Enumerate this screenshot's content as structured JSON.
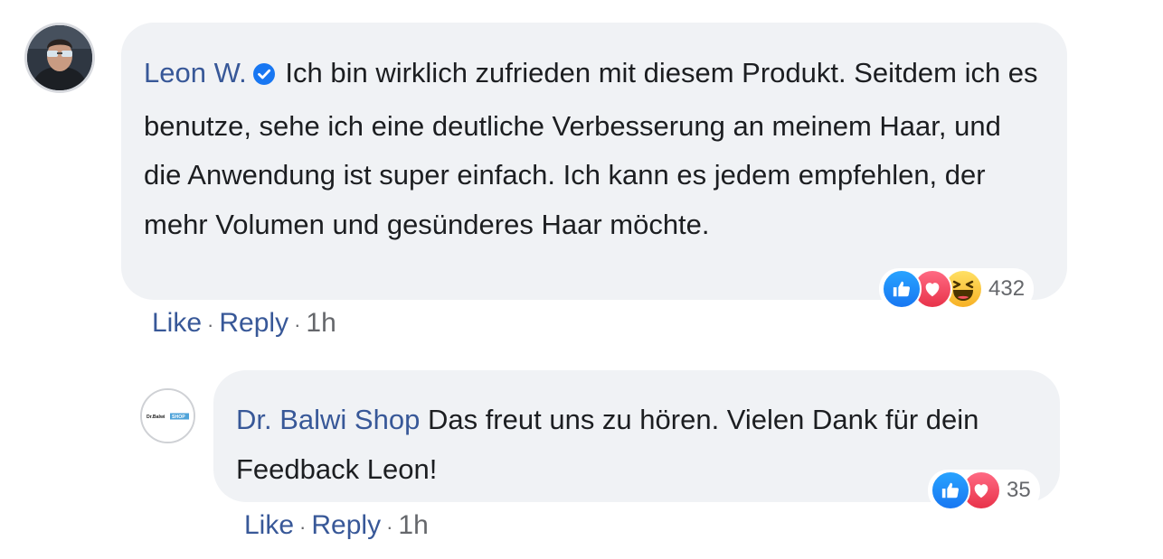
{
  "comment": {
    "author": "Leon W.",
    "verified_icon": "verified-check-icon",
    "text": "Ich bin wirklich zufrieden mit diesem Produkt. Seitdem ich es benutze, sehe ich eine deutliche Verbesserung an meinem Haar, und die Anwendung ist super einfach. Ich kann es jedem empfehlen, der mehr Volumen und gesünderes Haar möchte.",
    "reactions": [
      "like",
      "love",
      "haha"
    ],
    "reaction_count": "432",
    "actions": {
      "like": "Like",
      "separator": "·",
      "reply": "Reply",
      "time": "1h"
    }
  },
  "reply": {
    "author": "Dr. Balwi Shop",
    "avatar_logo_text": "Dr.Balwi SHOP",
    "text": "Das freut uns zu hören. Vielen Dank für dein Feedback Leon!",
    "reactions": [
      "like",
      "love"
    ],
    "reaction_count": "35",
    "actions": {
      "like": "Like",
      "separator": "·",
      "reply": "Reply",
      "time": "1h"
    }
  },
  "colors": {
    "link": "#385898",
    "bubble": "#f0f2f5",
    "text": "#1c1e21",
    "muted": "#65676b",
    "like": "#1877f2",
    "love": "#e8334a",
    "haha": "#f7b125"
  }
}
